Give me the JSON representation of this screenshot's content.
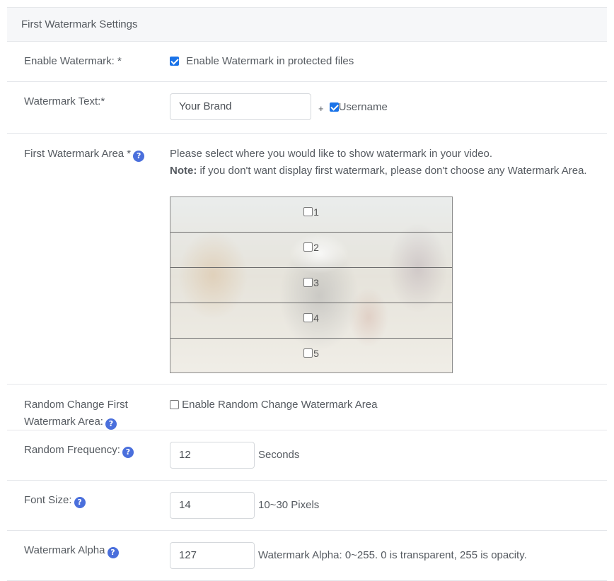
{
  "panel": {
    "title": "First Watermark Settings"
  },
  "enable_watermark": {
    "label": "Enable Watermark: *",
    "checkbox_label": "Enable Watermark in protected files",
    "checked": true
  },
  "watermark_text": {
    "label": "Watermark Text:*",
    "value": "Your Brand",
    "plus": "+",
    "username_label": "Username",
    "username_checked": true
  },
  "first_area": {
    "label": "First Watermark Area *",
    "description": "Please select where you would like to show watermark in your video.",
    "note_bold": "Note:",
    "note_text": " if you don't want display first watermark, please don't choose any Watermark Area.",
    "areas": [
      "1",
      "2",
      "3",
      "4",
      "5"
    ]
  },
  "random_change": {
    "label_line1": "Random Change First",
    "label_line2": "Watermark Area:",
    "checkbox_label": "Enable Random Change Watermark Area",
    "checked": false
  },
  "random_frequency": {
    "label": "Random Frequency:",
    "value": "12",
    "suffix": "Seconds"
  },
  "font_size": {
    "label": "Font Size:",
    "value": "14",
    "suffix": "10~30 Pixels"
  },
  "watermark_alpha": {
    "label": "Watermark Alpha",
    "value": "127",
    "suffix": "Watermark Alpha: 0~255. 0 is transparent, 255 is opacity."
  },
  "help_glyph": "?",
  "colors": {
    "accent": "#4a6fdc",
    "checkbox": "#1a73e8"
  }
}
